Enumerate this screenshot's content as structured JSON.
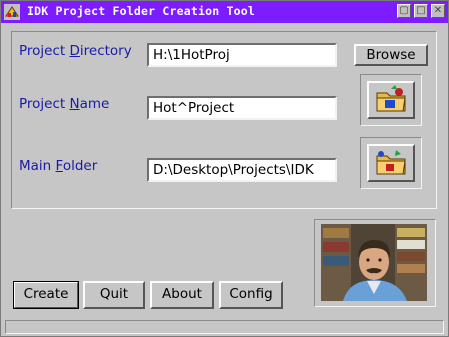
{
  "window": {
    "title": "IDK Project Folder Creation Tool",
    "title_bar_color": "#7c1cff"
  },
  "title_buttons": [
    {
      "name": "restore-button",
      "glyph": "▢"
    },
    {
      "name": "maximize-button",
      "glyph": "□"
    },
    {
      "name": "close-button",
      "glyph": "✕"
    }
  ],
  "form": {
    "project_directory": {
      "label_pre": "Project ",
      "label_ul": "D",
      "label_post": "irectory",
      "value": "H:\\1HotProj"
    },
    "project_name": {
      "label_pre": "Project ",
      "label_ul": "N",
      "label_post": "ame",
      "value": "Hot^Project"
    },
    "main_folder": {
      "label_pre": "Main ",
      "label_ul": "F",
      "label_post": "older",
      "value": "D:\\Desktop\\Projects\\IDK"
    },
    "browse_label": "Browse"
  },
  "icons": {
    "app": "app-icon",
    "folder_one": "folder-icon",
    "folder_two": "folder-icon"
  },
  "buttons": {
    "create": "Create",
    "quit": "Quit",
    "about": "About",
    "config": "Config"
  },
  "colors": {
    "label": "#1a1aa6",
    "face": "#c6c6c6"
  }
}
